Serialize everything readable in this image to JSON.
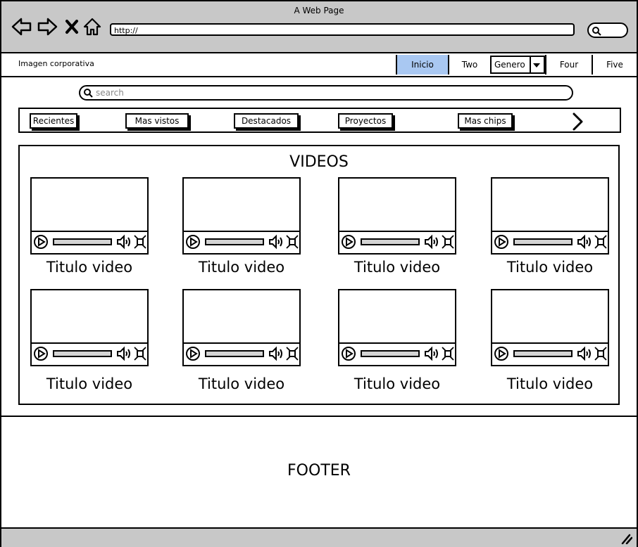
{
  "browser": {
    "window_title": "A Web Page",
    "url": "http://",
    "buttons": [
      "back-arrow-icon",
      "forward-arrow-icon",
      "close-x-icon",
      "home-icon"
    ],
    "search_icon": "search-icon"
  },
  "header": {
    "brand": "Imagen corporativa",
    "tabs": [
      {
        "label": "Inicio",
        "active": true
      },
      {
        "label": "Two",
        "active": false
      },
      {
        "label": "Genero",
        "dropdown": true
      },
      {
        "label": "Four",
        "active": false
      },
      {
        "label": "Five",
        "active": false
      }
    ],
    "active_color": "#a9c8f2"
  },
  "search": {
    "placeholder": "search"
  },
  "chips": {
    "items": [
      "Recientes",
      "Mas vistos",
      "Destacados",
      "Proyectos",
      "Mas chips"
    ],
    "next_icon": "chevron-right-icon"
  },
  "videos": {
    "title": "VIDEOS",
    "items": [
      {
        "caption": "Titulo video"
      },
      {
        "caption": "Titulo video"
      },
      {
        "caption": "Titulo video"
      },
      {
        "caption": "Titulo video"
      },
      {
        "caption": "Titulo video"
      },
      {
        "caption": "Titulo video"
      },
      {
        "caption": "Titulo video"
      },
      {
        "caption": "Titulo video"
      }
    ]
  },
  "footer": {
    "label": "FOOTER"
  },
  "colors": {
    "chrome": "#c8c8c8",
    "seekbar": "#d4d4d4"
  }
}
